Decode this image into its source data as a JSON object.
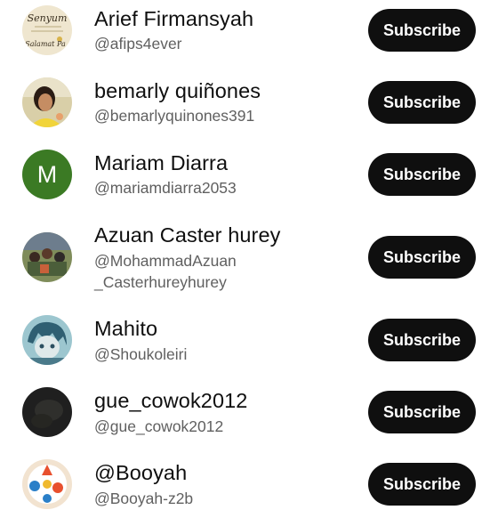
{
  "channels": [
    {
      "name": "Arief Firmansyah",
      "handle": "@afips4ever",
      "avatar_icon": "senyum-quote-avatar",
      "avatar_text_1": "Senyum",
      "avatar_text_2": "Salamat Pa",
      "subscribe_label": "Subscribe"
    },
    {
      "name": "bemarly quiñones",
      "handle": "@bemarlyquinones391",
      "avatar_icon": "woman-photo-avatar",
      "subscribe_label": "Subscribe"
    },
    {
      "name": "Mariam Diarra",
      "handle": "@mariamdiarra2053",
      "avatar_letter": "M",
      "avatar_color": "#3b7a24",
      "subscribe_label": "Subscribe"
    },
    {
      "name": "Azuan Caster hurey",
      "handle_line1": "@MohammadAzuan",
      "handle_line2": "_Casterhureyhurey",
      "avatar_icon": "group-photo-avatar",
      "subscribe_label": "Subscribe"
    },
    {
      "name": "Mahito",
      "handle": "@Shoukoleiri",
      "avatar_icon": "anime-character-avatar",
      "subscribe_label": "Subscribe"
    },
    {
      "name": "gue_cowok2012",
      "handle": "@gue_cowok2012",
      "avatar_icon": "dark-photo-avatar",
      "subscribe_label": "Subscribe"
    },
    {
      "name": "@Booyah",
      "handle": "@Booyah-z2b",
      "avatar_icon": "colorful-ball-avatar",
      "subscribe_label": "Subscribe"
    }
  ]
}
